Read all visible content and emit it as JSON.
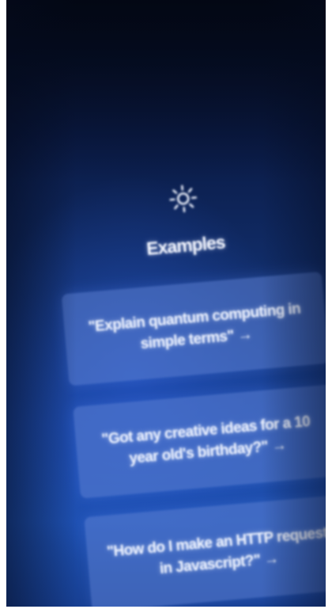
{
  "examples": {
    "icon": "sun-icon",
    "title": "Examples",
    "items": [
      {
        "label": "\"Explain quantum computing in simple terms\" →"
      },
      {
        "label": "\"Got any creative ideas for a 10 year old's birthday?\" →"
      },
      {
        "label": "\"How do I make an HTTP request in Javascript?\" →"
      }
    ]
  },
  "colors": {
    "background_top": "#050b1a",
    "background_bottom": "#1d4fae",
    "card": "#5c82d7",
    "text": "#eef3ff"
  }
}
